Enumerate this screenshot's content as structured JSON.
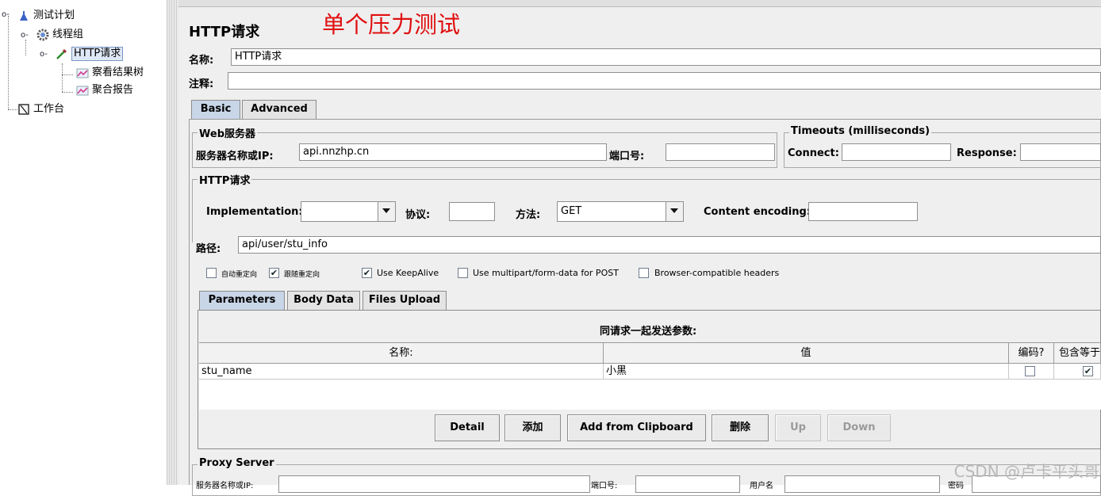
{
  "annotation": "单个压力测试",
  "watermark": "CSDN @卢卡平头哥",
  "tree": {
    "test_plan": "测试计划",
    "thread_group": "线程组",
    "http_request": "HTTP请求",
    "view_results_tree": "察看结果树",
    "aggregate_report": "聚合报告",
    "workbench": "工作台"
  },
  "header": {
    "title": "HTTP请求",
    "name_label": "名称:",
    "name_value": "HTTP请求",
    "comment_label": "注释:",
    "comment_value": ""
  },
  "tabs": [
    "Basic",
    "Advanced"
  ],
  "web_server": {
    "title": "Web服务器",
    "server_label": "服务器名称或IP:",
    "server_value": "api.nnzhp.cn",
    "port_label": "端口号:",
    "port_value": ""
  },
  "timeouts": {
    "title": "Timeouts (milliseconds)",
    "connect_label": "Connect:",
    "connect_value": "",
    "response_label": "Response:",
    "response_value": ""
  },
  "http_request": {
    "title": "HTTP请求",
    "implementation_label": "Implementation:",
    "implementation_value": "",
    "protocol_label": "协议:",
    "protocol_value": "",
    "method_label": "方法:",
    "method_value": "GET",
    "encoding_label": "Content encoding:",
    "encoding_value": "",
    "path_label": "路径:",
    "path_value": "api/user/stu_info"
  },
  "options": [
    {
      "label": "自动重定向",
      "checked": false
    },
    {
      "label": "跟随重定向",
      "checked": true
    },
    {
      "label": "Use KeepAlive",
      "checked": true
    },
    {
      "label": "Use multipart/form-data for POST",
      "checked": false
    },
    {
      "label": "Browser-compatible headers",
      "checked": false
    }
  ],
  "param_tabs": [
    "Parameters",
    "Body Data",
    "Files Upload"
  ],
  "params": {
    "caption": "同请求一起发送参数:",
    "columns": [
      "名称:",
      "值",
      "编码?",
      "包含等于?"
    ],
    "rows": [
      {
        "name": "stu_name",
        "value": "小黑",
        "encode": false,
        "include_equals": true
      }
    ]
  },
  "buttons": {
    "detail": "Detail",
    "add": "添加",
    "add_clipboard": "Add from Clipboard",
    "delete": "删除",
    "up": "Up",
    "down": "Down"
  },
  "proxy": {
    "title": "Proxy Server",
    "server_label": "服务器名称或IP:",
    "port_label": "端口号:",
    "user_label": "用户名",
    "password_label": "密码"
  },
  "colors": {
    "annotation": "#e01010",
    "selection": "#dfe8f6",
    "active_tab": "#c9d6e8"
  }
}
